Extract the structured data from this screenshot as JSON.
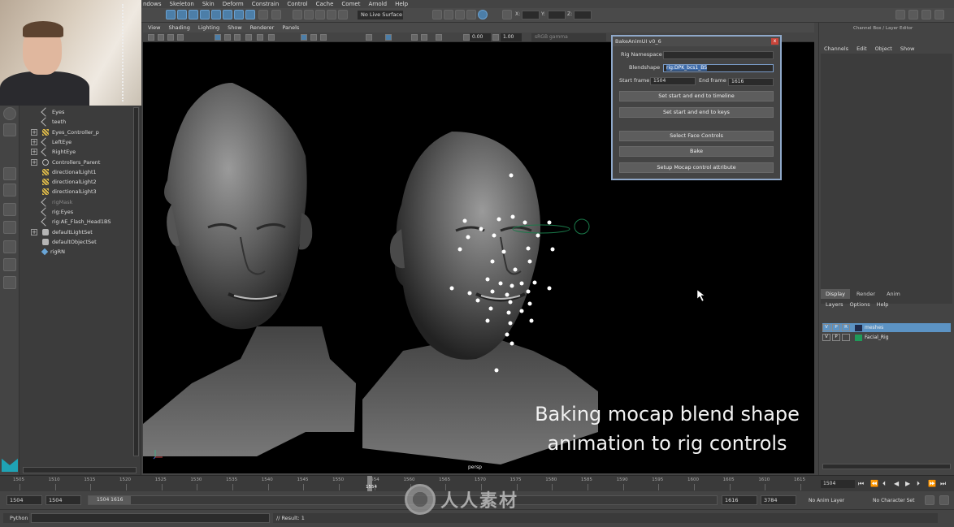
{
  "menubar": [
    "ndows",
    "Skeleton",
    "Skin",
    "Deform",
    "Constrain",
    "Control",
    "Cache",
    "Comet",
    "Arnold",
    "Help"
  ],
  "toolbar": {
    "live_surface": "No Live Surface",
    "x_label": "X:",
    "y_label": "Y:",
    "z_label": "Z:"
  },
  "outliner": {
    "items": [
      {
        "label": "Eyes",
        "icon": "joint-icon"
      },
      {
        "label": "teeth",
        "icon": "joint-icon"
      },
      {
        "label": "Eyes_Controller_p",
        "icon": "light-icon",
        "expandable": true
      },
      {
        "label": "LeftEye",
        "icon": "joint-icon",
        "expandable": true
      },
      {
        "label": "RightEye",
        "icon": "joint-icon",
        "expandable": true
      },
      {
        "label": "Controllers_Parent",
        "icon": "locator-icon",
        "expandable": true
      },
      {
        "label": "directionalLight1",
        "icon": "light-icon"
      },
      {
        "label": "directionalLight2",
        "icon": "light-icon"
      },
      {
        "label": "directionalLight3",
        "icon": "light-icon"
      },
      {
        "label": "rigMask",
        "icon": "joint-icon",
        "grey": true
      },
      {
        "label": "rig:Eyes",
        "icon": "joint-icon"
      },
      {
        "label": "rig:AE_Flash_Head1BS",
        "icon": "joint-icon"
      },
      {
        "label": "defaultLightSet",
        "icon": "set-icon",
        "expandable": true
      },
      {
        "label": "defaultObjectSet",
        "icon": "set-icon"
      },
      {
        "label": "rigRN",
        "icon": "reference-icon"
      }
    ]
  },
  "viewport": {
    "menu": [
      "View",
      "Shading",
      "Lighting",
      "Show",
      "Renderer",
      "Panels"
    ],
    "field_a": "0.00",
    "field_b": "1.00",
    "color_space": "sRGB gamma",
    "camera_label": "persp",
    "caption_line1": "Baking mocap blend shape",
    "caption_line2": "animation to rig controls"
  },
  "bake_dialog": {
    "title": "BakeAnimUI v0_6",
    "close": "x",
    "rig_namespace_label": "Rig Namespace",
    "rig_namespace_value": "",
    "blendshape_label": "Blendshape",
    "blendshape_value": "rig:DPK_bcs1_BS",
    "start_frame_label": "Start frame",
    "start_frame_value": "1504",
    "end_frame_label": "End frame",
    "end_frame_value": "1616",
    "btn_timeline": "Set start and end to timeline",
    "btn_keys": "Set start and end to keys",
    "btn_select": "Select Face Controls",
    "btn_bake": "Bake",
    "btn_setup": "Setup Mocap control attribute"
  },
  "right_panel": {
    "title": "Channel Box / Layer Editor",
    "menu": [
      "Channels",
      "Edit",
      "Object",
      "Show"
    ],
    "tabs": [
      "Display",
      "Render",
      "Anim"
    ],
    "layer_menu": [
      "Layers",
      "Options",
      "Help"
    ],
    "layers": [
      {
        "v": "V",
        "p": "P",
        "r": "R",
        "name": "meshes",
        "color": "#1e2a4a",
        "selected": true
      },
      {
        "v": "V",
        "p": "P",
        "r": "",
        "name": "Facial_Rig",
        "color": "#1f9a5a",
        "selected": false
      }
    ]
  },
  "timeline": {
    "ticks": [
      "1505",
      "1510",
      "1515",
      "1520",
      "1525",
      "1530",
      "1535",
      "1540",
      "1545",
      "1550",
      "1554",
      "1560",
      "1565",
      "1570",
      "1575",
      "1580",
      "1585",
      "1590",
      "1595",
      "1600",
      "1605",
      "1610",
      "1615"
    ],
    "current": "1554",
    "current_frame_field": "1504"
  },
  "range": {
    "start_outer": "1504",
    "start_inner": "1504",
    "handle": "1504 1616",
    "end_inner": "1616",
    "end_outer": "3784",
    "anim_layer": "No Anim Layer",
    "character_set": "No Character Set"
  },
  "cmdline": {
    "language": "Python",
    "result": "// Result: 1"
  },
  "watermark": "人人素材"
}
